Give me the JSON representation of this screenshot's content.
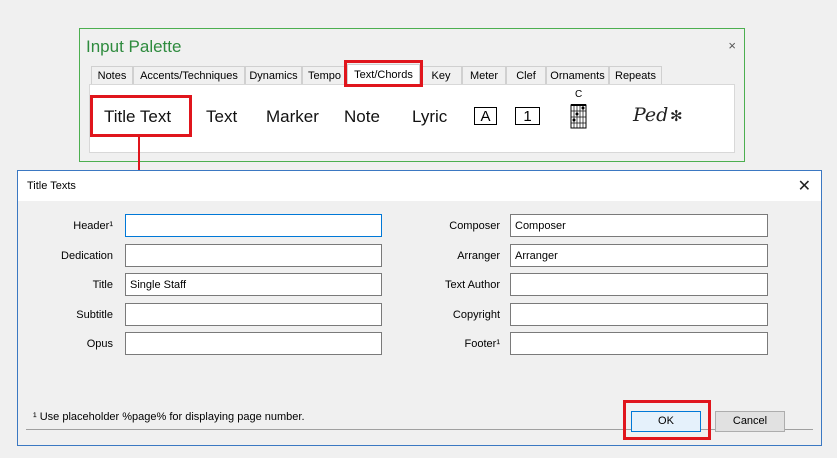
{
  "palette": {
    "title": "Input Palette",
    "close_icon": "×",
    "tabs": [
      "Notes",
      "Accents/Techniques",
      "Dynamics",
      "Tempo",
      "Text/Chords",
      "Key",
      "Meter",
      "Clef",
      "Ornaments",
      "Repeats"
    ],
    "active_tab": "Text/Chords",
    "items": {
      "title_text": "Title Text",
      "text": "Text",
      "marker": "Marker",
      "note": "Note",
      "lyric": "Lyric",
      "boxed_letter": "A",
      "boxed_number": "1",
      "chord_name": "C",
      "chord_diagram_icon": "guitar-chord-diagram-icon",
      "pedal": "Ped",
      "pedal_release": "✻"
    },
    "highlight_color": "#e0151c"
  },
  "dialog": {
    "title": "Title Texts",
    "close_icon": "✕",
    "left_fields": [
      {
        "label": "Header¹",
        "value": ""
      },
      {
        "label": "Dedication",
        "value": ""
      },
      {
        "label": "Title",
        "value": "Single Staff"
      },
      {
        "label": "Subtitle",
        "value": ""
      },
      {
        "label": "Opus",
        "value": ""
      }
    ],
    "right_fields": [
      {
        "label": "Composer",
        "value": "Composer"
      },
      {
        "label": "Arranger",
        "value": "Arranger"
      },
      {
        "label": "Text Author",
        "value": ""
      },
      {
        "label": "Copyright",
        "value": ""
      },
      {
        "label": "Footer¹",
        "value": ""
      }
    ],
    "footnote": "¹ Use placeholder %page% for displaying page number.",
    "ok_label": "OK",
    "cancel_label": "Cancel"
  }
}
